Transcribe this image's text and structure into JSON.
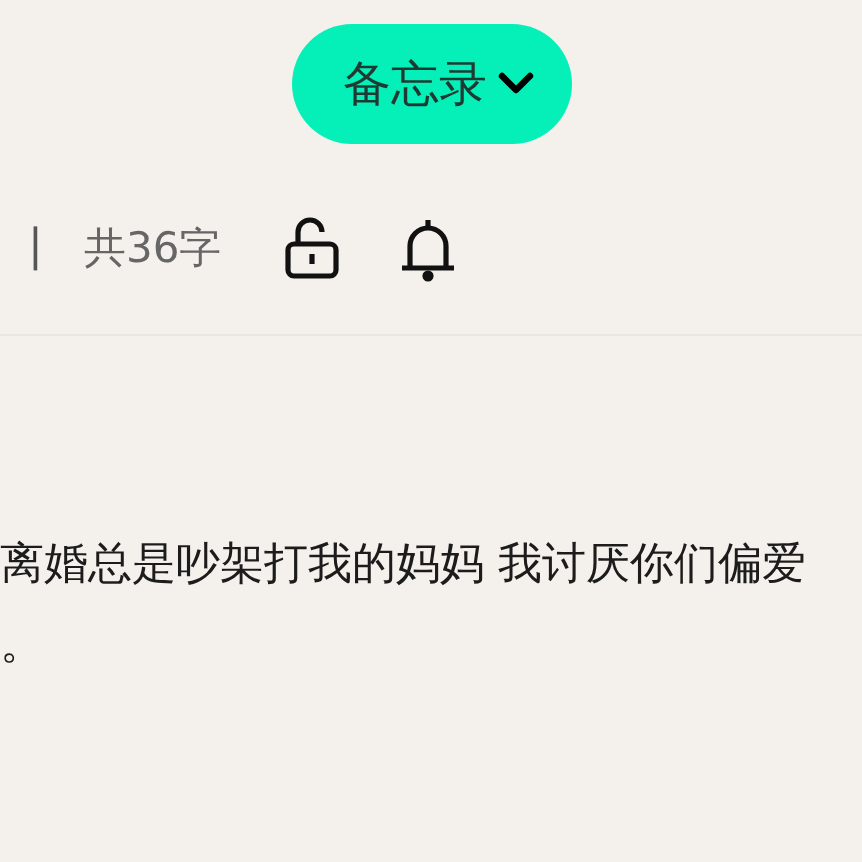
{
  "folder_button": {
    "label": "备忘录"
  },
  "info_bar": {
    "cursor": "|",
    "word_count": "共36字"
  },
  "note_lines": [
    "离婚总是吵架打我的妈妈 我讨厌你们偏爱",
    "。"
  ]
}
